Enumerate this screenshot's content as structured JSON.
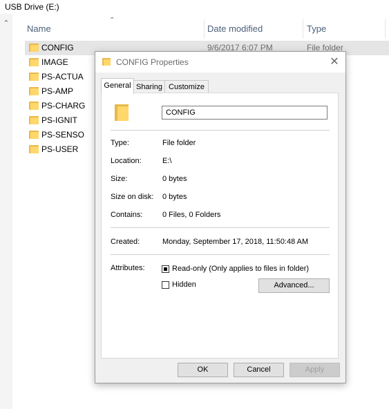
{
  "window": {
    "title": "USB Drive (E:)"
  },
  "columns": {
    "name": "Name",
    "date": "Date modified",
    "type": "Type"
  },
  "files": [
    {
      "name": "CONFIG",
      "date": "9/6/2017 6:07 PM",
      "type": "File folder"
    },
    {
      "name": "IMAGE"
    },
    {
      "name": "PS-ACTUA"
    },
    {
      "name": "PS-AMP"
    },
    {
      "name": "PS-CHARG"
    },
    {
      "name": "PS-IGNIT"
    },
    {
      "name": "PS-SENSO"
    },
    {
      "name": "PS-USER"
    }
  ],
  "dialog": {
    "title": "CONFIG Properties",
    "tabs": [
      "General",
      "Sharing",
      "Customize"
    ],
    "folder_name": "CONFIG",
    "props": [
      {
        "label": "Type:",
        "value": "File folder"
      },
      {
        "label": "Location:",
        "value": "E:\\"
      },
      {
        "label": "Size:",
        "value": "0 bytes"
      },
      {
        "label": "Size on disk:",
        "value": "0 bytes"
      },
      {
        "label": "Contains:",
        "value": "0 Files, 0 Folders"
      }
    ],
    "created_label": "Created:",
    "created_value": "Monday, September 17, 2018, 11:50:48 AM",
    "attributes_label": "Attributes:",
    "readonly_label": "Read-only (Only applies to files in folder)",
    "hidden_label": "Hidden",
    "advanced_label": "Advanced...",
    "ok_label": "OK",
    "cancel_label": "Cancel",
    "apply_label": "Apply"
  }
}
